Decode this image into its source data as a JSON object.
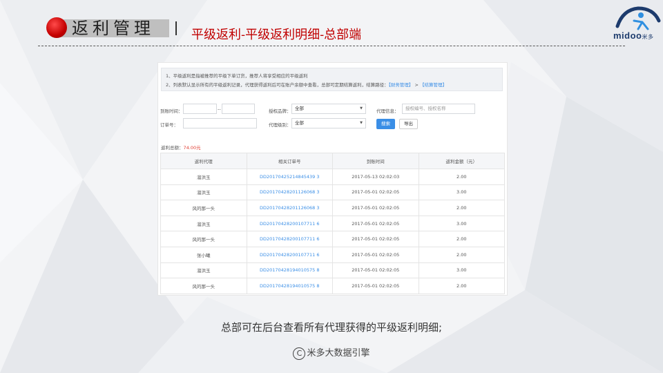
{
  "slide": {
    "title": "返利管理",
    "subtitle": "平级返利-平级返利明细-总部端",
    "caption": "总部可在后台查看所有代理获得的平级返利明细;",
    "footer_symbol": "C",
    "footer_text": "米多大数据引擎",
    "accent_color": "#c00000"
  },
  "logo": {
    "text": "midoo",
    "suffix": "米多"
  },
  "notice": {
    "line1": "1、平级返利是指被推荐的平级下单订货，推荐人将享受相应的平级返利",
    "line2": "2、列表默认显示所有的平级返利记录，代理获得返利后可在账户余额中查看，总部可定期结算返利，结算路径：",
    "link1": "【财务管理】",
    "arrow": " > ",
    "link2": "【结算管理】"
  },
  "filters": {
    "date_label": "到账时间：",
    "date_sep": "--",
    "brand_label": "授权品牌：",
    "brand_value": "全部",
    "agent_info_label": "代理信息：",
    "agent_info_placeholder": "授权编号、授权名称",
    "order_label": "订单号：",
    "level_label": "代理级别：",
    "level_value": "全部",
    "search_button": "搜索",
    "export_button": "导出"
  },
  "summary": {
    "label": "返利总额：",
    "amount": "74.00元"
  },
  "table": {
    "headers": [
      "返利代理",
      "相关订单号",
      "到账时间",
      "返利金额（元）"
    ],
    "rows": [
      [
        "溜洪玉",
        "DD20170425214845439 3",
        "2017-05-13 02:02:03",
        "2.00"
      ],
      [
        "溜洪玉",
        "DD20170428201126068 3",
        "2017-05-01 02:02:05",
        "3.00"
      ],
      [
        "风的那一头",
        "DD20170428201126068 3",
        "2017-05-01 02:02:05",
        "2.00"
      ],
      [
        "溜洪玉",
        "DD20170428200107711 6",
        "2017-05-01 02:02:05",
        "3.00"
      ],
      [
        "风的那一头",
        "DD20170428200107711 6",
        "2017-05-01 02:02:05",
        "2.00"
      ],
      [
        "张小曦",
        "DD20170428200107711 6",
        "2017-05-01 02:02:05",
        "2.00"
      ],
      [
        "溜洪玉",
        "DD20170428194010575 8",
        "2017-05-01 02:02:05",
        "3.00"
      ],
      [
        "风的那一头",
        "DD20170428194010575 8",
        "2017-05-01 02:02:05",
        "2.00"
      ]
    ]
  }
}
